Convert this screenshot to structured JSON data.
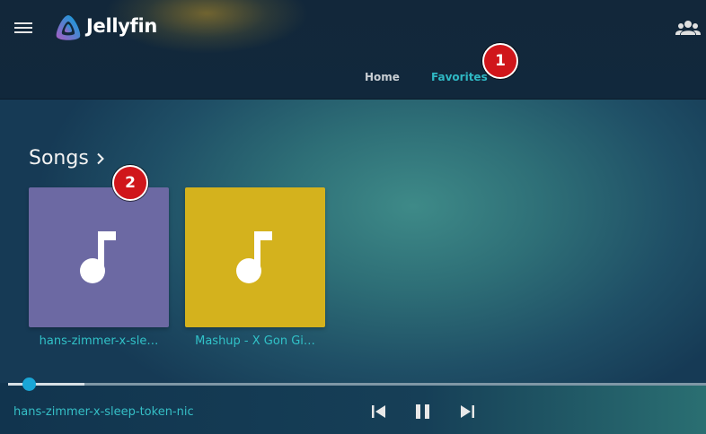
{
  "app": {
    "brand": "Jellyfin",
    "menu_icon": "hamburger-menu-icon",
    "logo_icon": "jellyfin-logo-icon",
    "users_icon": "users-icon"
  },
  "tabs": [
    {
      "label": "Home",
      "active": false
    },
    {
      "label": "Favorites",
      "active": true
    }
  ],
  "markers": [
    "1",
    "2"
  ],
  "section": {
    "title": "Songs",
    "chevron_icon": "chevron-right-icon"
  },
  "cards": [
    {
      "title": "hans-zimmer-x-sle…",
      "color": "#6c69a3",
      "icon": "music-note-icon"
    },
    {
      "title": "Mashup - X Gon Gi…",
      "color": "#d4b21d",
      "icon": "music-note-icon"
    }
  ],
  "player": {
    "now_playing": "hans-zimmer-x-sleep-token-nic",
    "progress": 0.03,
    "buffered": 0.11,
    "prev_icon": "skip-previous-icon",
    "pause_icon": "pause-icon",
    "next_icon": "skip-next-icon"
  },
  "colors": {
    "accent": "#2fb8c4",
    "marker": "#d0161b"
  }
}
